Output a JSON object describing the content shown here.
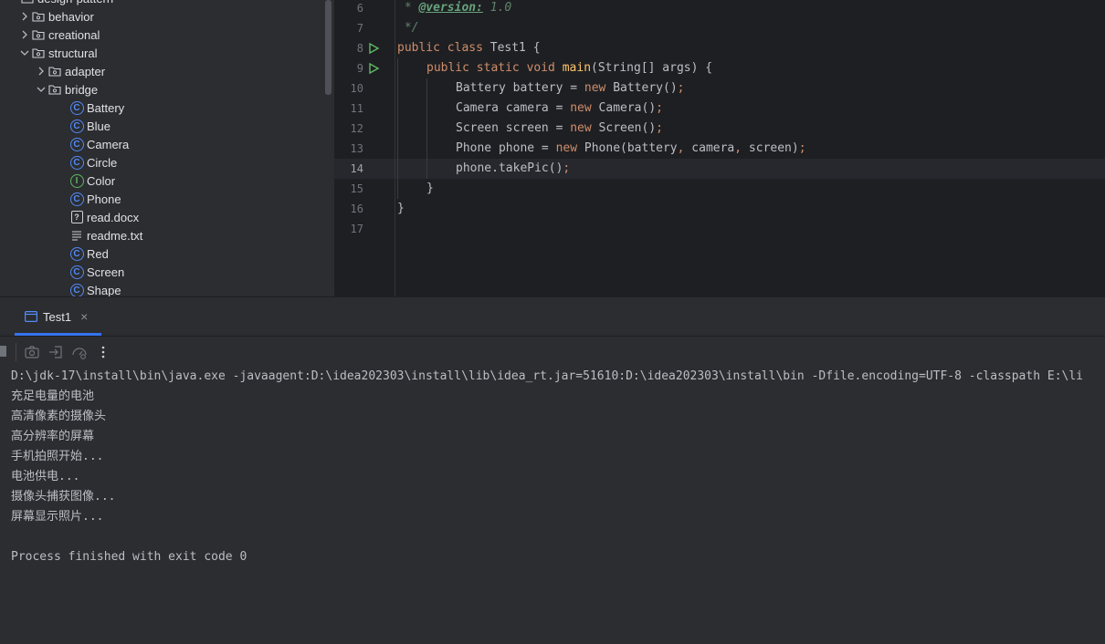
{
  "project_tree": {
    "items": [
      {
        "label": "design-pattern",
        "type": "folder",
        "expanded": true
      },
      {
        "label": "behavior",
        "type": "folder",
        "expanded": false
      },
      {
        "label": "creational",
        "type": "folder",
        "expanded": false
      },
      {
        "label": "structural",
        "type": "folder",
        "expanded": true
      },
      {
        "label": "adapter",
        "type": "folder",
        "expanded": false
      },
      {
        "label": "bridge",
        "type": "folder",
        "expanded": true
      },
      {
        "label": "Battery",
        "type": "class"
      },
      {
        "label": "Blue",
        "type": "class"
      },
      {
        "label": "Camera",
        "type": "class"
      },
      {
        "label": "Circle",
        "type": "class"
      },
      {
        "label": "Color",
        "type": "interface"
      },
      {
        "label": "Phone",
        "type": "class"
      },
      {
        "label": "read.docx",
        "type": "unknown-file"
      },
      {
        "label": "readme.txt",
        "type": "text-file"
      },
      {
        "label": "Red",
        "type": "class"
      },
      {
        "label": "Screen",
        "type": "class"
      },
      {
        "label": "Shape",
        "type": "class"
      }
    ]
  },
  "editor": {
    "current_line": "14",
    "lines": [
      {
        "num": "6"
      },
      {
        "num": "7"
      },
      {
        "num": "8"
      },
      {
        "num": "9"
      },
      {
        "num": "10"
      },
      {
        "num": "11"
      },
      {
        "num": "12"
      },
      {
        "num": "13"
      },
      {
        "num": "14"
      },
      {
        "num": "15"
      },
      {
        "num": "16"
      },
      {
        "num": "17"
      }
    ],
    "code": {
      "l6_star": " * ",
      "l6_tag": "@version:",
      "l6_val": " 1.0",
      "l7": " */",
      "l8_kw": "public class",
      "l8_name": " Test1 {",
      "l9_kw": "public static void",
      "l9_fn": "main",
      "l9_rest": "(String[] args) {",
      "l10_type": "Battery battery = ",
      "l10_new": "new",
      "l10_ctor": " Battery()",
      "l11_type": "Camera camera = ",
      "l11_new": "new",
      "l11_ctor": " Camera()",
      "l12_type": "Screen screen = ",
      "l12_new": "new",
      "l12_ctor": " Screen()",
      "l13_type": "Phone phone = ",
      "l13_new": "new",
      "l13_ctor": " Phone(battery",
      "l13_c1": ",",
      "l13_a2": " camera",
      "l13_c2": ",",
      "l13_a3": " screen)",
      "l14_call": "phone.takePic()",
      "semicolon": ";",
      "l15": "}",
      "l16": "}"
    }
  },
  "run_window": {
    "tab_label": "Test1",
    "console_lines": [
      "D:\\jdk-17\\install\\bin\\java.exe -javaagent:D:\\idea202303\\install\\lib\\idea_rt.jar=51610:D:\\idea202303\\install\\bin -Dfile.encoding=UTF-8 -classpath E:\\li",
      "充足电量的电池",
      "高清像素的摄像头",
      "高分辨率的屏幕",
      "手机拍照开始...",
      "电池供电...",
      "摄像头捕获图像...",
      "屏幕显示照片...",
      "",
      "Process finished with exit code 0"
    ]
  },
  "colors": {
    "accent": "#3574f0",
    "class_icon": "#548af7",
    "interface_icon": "#5fb865",
    "run_gutter": "#5fb865"
  }
}
